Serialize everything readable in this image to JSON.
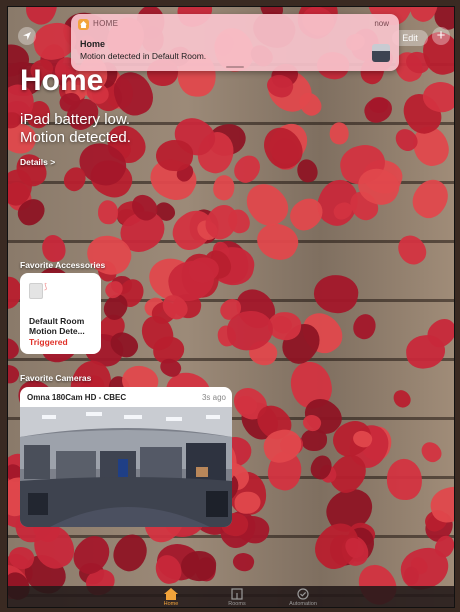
{
  "notification": {
    "app_name": "HOME",
    "time": "now",
    "title": "Home",
    "body": "Motion detected in Default Room."
  },
  "toolbar": {
    "edit_label": "Edit",
    "add_label": "+"
  },
  "page": {
    "title": "Home",
    "status_line1": "iPad battery low.",
    "status_line2": "Motion detected.",
    "details_link": "Details >"
  },
  "sections": {
    "accessories_label": "Favorite Accessories",
    "cameras_label": "Favorite Cameras"
  },
  "accessory": {
    "name": "Default Room Motion Dete...",
    "state": "Triggered",
    "icon": "motion-sensor-icon",
    "state_color": "#e0322a"
  },
  "camera": {
    "name": "Omna 180Cam HD - CBEC",
    "time": "3s ago"
  },
  "tabs": [
    {
      "label": "Home",
      "icon": "house-icon",
      "active": true
    },
    {
      "label": "Rooms",
      "icon": "rooms-icon",
      "active": false
    },
    {
      "label": "Automation",
      "icon": "clock-check-icon",
      "active": false
    }
  ],
  "colors": {
    "accent": "#f2a33a",
    "notification_bg": "#f8c4cd",
    "ivy_red": "#c8283a"
  }
}
